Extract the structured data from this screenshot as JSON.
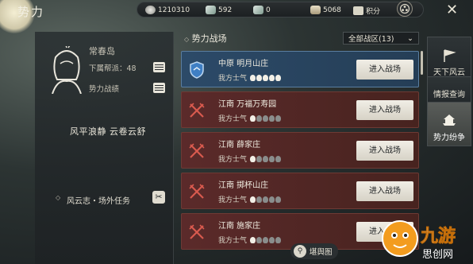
{
  "header": {
    "title": "势力"
  },
  "resources": [
    {
      "icon": "silver-coin-icon",
      "value": "1210310"
    },
    {
      "icon": "jade-icon",
      "value": "592"
    },
    {
      "icon": "token-icon",
      "value": "0"
    },
    {
      "icon": "scroll-icon",
      "value": "5068"
    },
    {
      "icon": "badge-icon",
      "value": "积分"
    }
  ],
  "profile": {
    "island": "常春岛",
    "members_label": "下属帮派：48",
    "record_label": "势力战绩",
    "motto": "风平浪静  云卷云舒",
    "quest_label": "风云志・场外任务"
  },
  "battlefield": {
    "title": "势力战场",
    "filter": "全部战区(13)",
    "morale_label": "我方士气",
    "enter_label": "进入战场",
    "rows": [
      {
        "region": "中原",
        "name": "明月山庄",
        "style": "blue",
        "morale": 5
      },
      {
        "region": "江南",
        "name": "万福万寿园",
        "style": "red",
        "morale": 1
      },
      {
        "region": "江南",
        "name": "薛家庄",
        "style": "red",
        "morale": 1
      },
      {
        "region": "江南",
        "name": "掷杯山庄",
        "style": "red",
        "morale": 1
      },
      {
        "region": "江南",
        "name": "施家庄",
        "style": "red",
        "morale": 1
      }
    ]
  },
  "tabs": [
    {
      "label": "天下风云",
      "active": false
    },
    {
      "label": "情报查询",
      "active": false
    },
    {
      "label": "势力纷争",
      "active": true
    }
  ],
  "bottom": {
    "search_label": "堪舆图"
  },
  "watermark": {
    "text": "九游",
    "sub": "思创网"
  },
  "colors": {
    "blue_row": "#2c4a68",
    "red_row": "#5b2a2a",
    "button": "#f1eee6"
  }
}
